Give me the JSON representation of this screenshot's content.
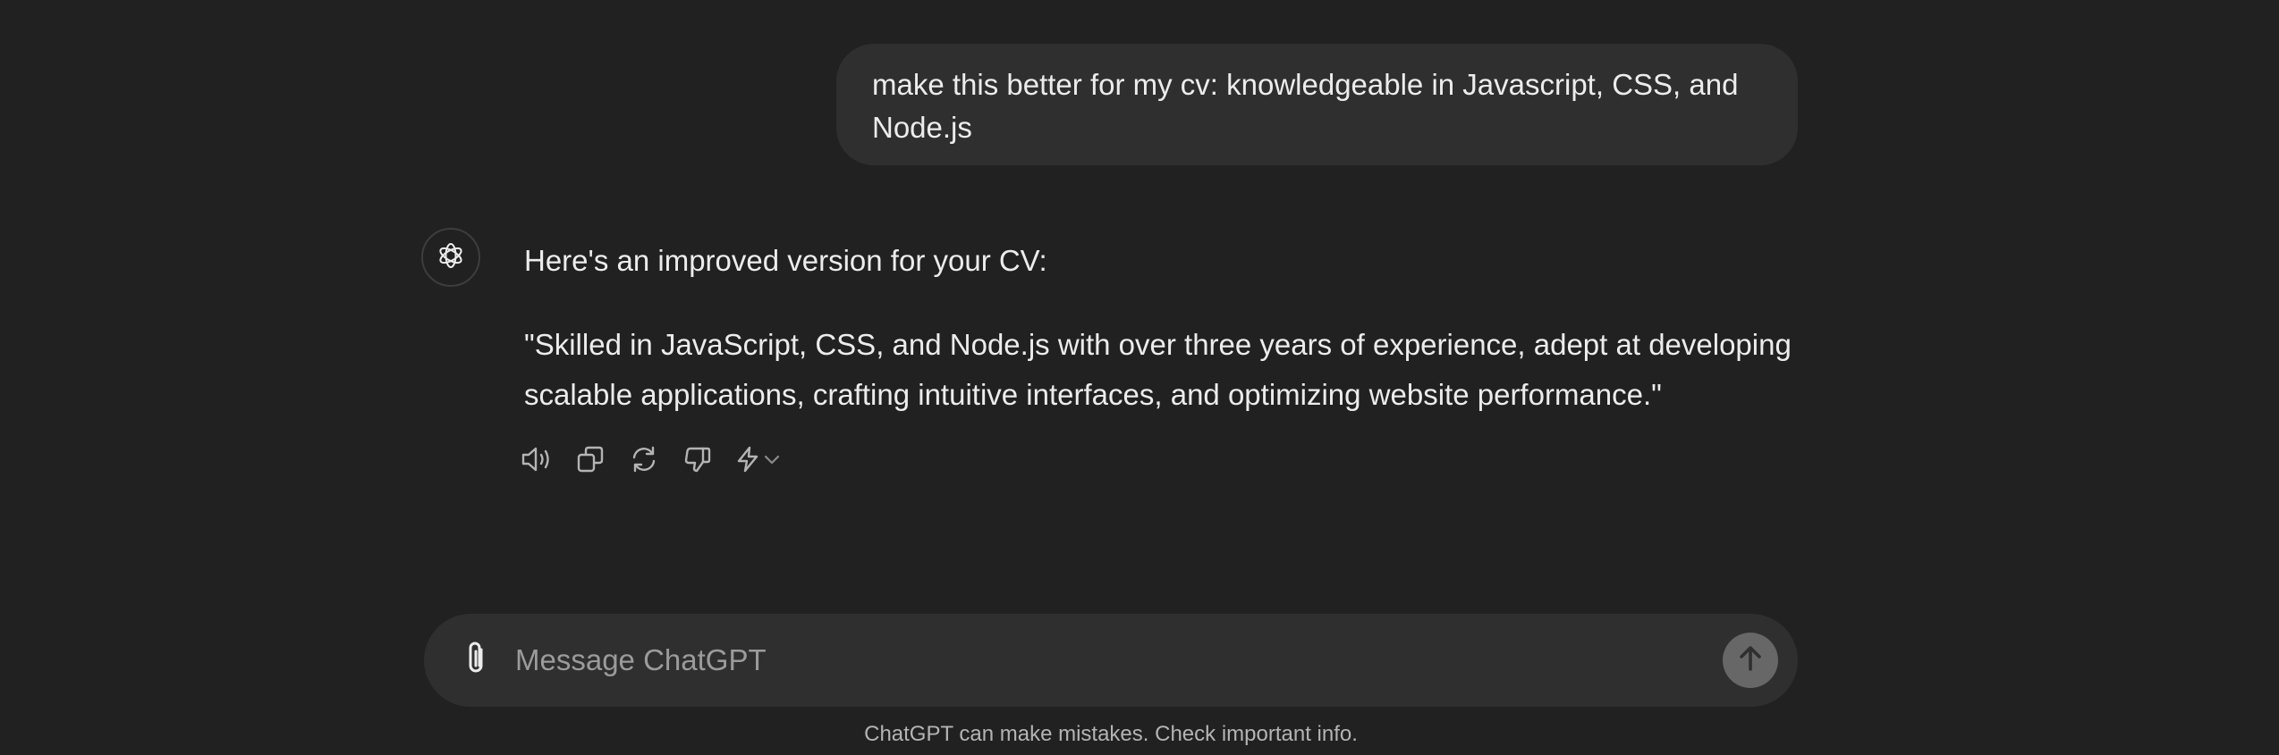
{
  "conversation": {
    "user_message": "make this better for my cv: knowledgeable in Javascript, CSS, and Node.js",
    "assistant_intro": "Here's an improved version for your CV:",
    "assistant_quote": "\"Skilled in JavaScript, CSS, and Node.js with over three years of experience, adept at developing scalable applications, crafting intuitive interfaces, and optimizing website performance.\""
  },
  "actions": {
    "icons": [
      "speaker-icon",
      "copy-icon",
      "regenerate-icon",
      "thumbs-down-icon",
      "lightning-icon",
      "chevron-down-icon"
    ]
  },
  "composer": {
    "placeholder": "Message ChatGPT",
    "value": ""
  },
  "footer": {
    "disclaimer": "ChatGPT can make mistakes. Check important info."
  },
  "colors": {
    "background": "#212121",
    "bubble": "#2f2f2f",
    "text": "#ececec",
    "muted": "#9b9b9b",
    "send_button": "#676767"
  }
}
